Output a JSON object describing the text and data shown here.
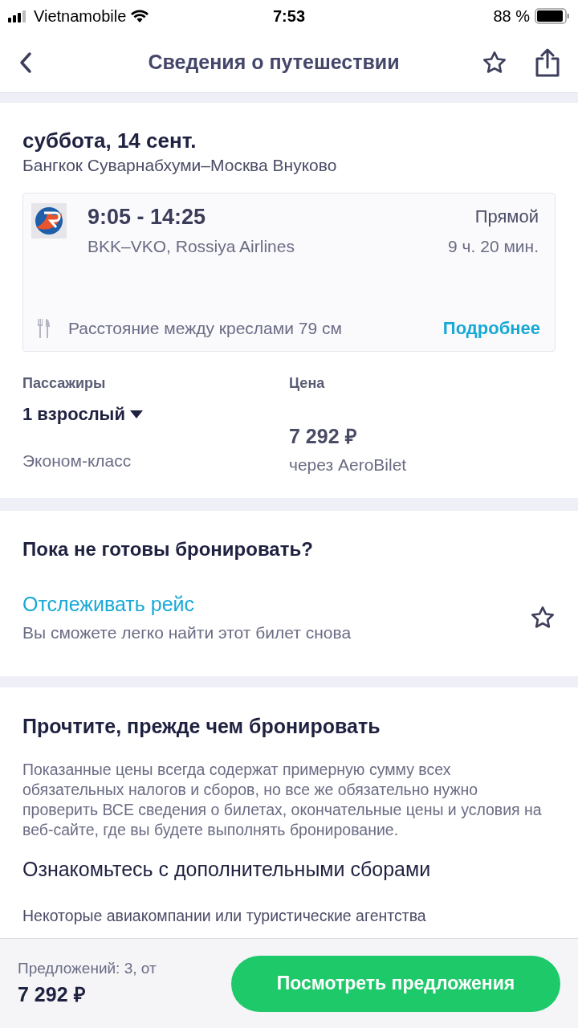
{
  "status_bar": {
    "carrier": "Vietnamobile",
    "time": "7:53",
    "battery": "88 %"
  },
  "header": {
    "title": "Сведения о путешествии"
  },
  "trip": {
    "date": "суббота, 14 сент.",
    "route": "Бангкок Суварнабхуми–Москва Внуково",
    "flight": {
      "times": "9:05 - 14:25",
      "codes": "BKK–VKO, Rossiya Airlines",
      "stops": "Прямой",
      "duration": "9 ч. 20 мин.",
      "seat_info": "Расстояние между креслами 79 см",
      "more_link": "Подробнее"
    },
    "passengers_label": "Пассажиры",
    "passengers": "1 взрослый",
    "cabin": "Эконом-класс",
    "price_label": "Цена",
    "price": "7 292 ₽",
    "via": "через AeroBilet"
  },
  "not_ready": {
    "title": "Пока не готовы бронировать?",
    "track_link": "Отслеживать рейс",
    "track_hint": "Вы сможете легко найти этот билет снова"
  },
  "read_before": {
    "title": "Прочтите, прежде чем бронировать",
    "text": "Показанные цены всегда содержат примерную сумму всех обязательных налогов и сборов, но все же обязательно нужно проверить ВСЕ сведения о билетах, окончательные цены и условия на веб-сайте, где вы будете выполнять бронирование.",
    "fees_title": "Ознакомьтесь с дополнительными сборами",
    "fees_text": "Некоторые авиакомпании или туристические агентства"
  },
  "footer": {
    "offers": "Предложений: 3, от",
    "price": "7 292 ₽",
    "button": "Посмотреть предложения"
  }
}
